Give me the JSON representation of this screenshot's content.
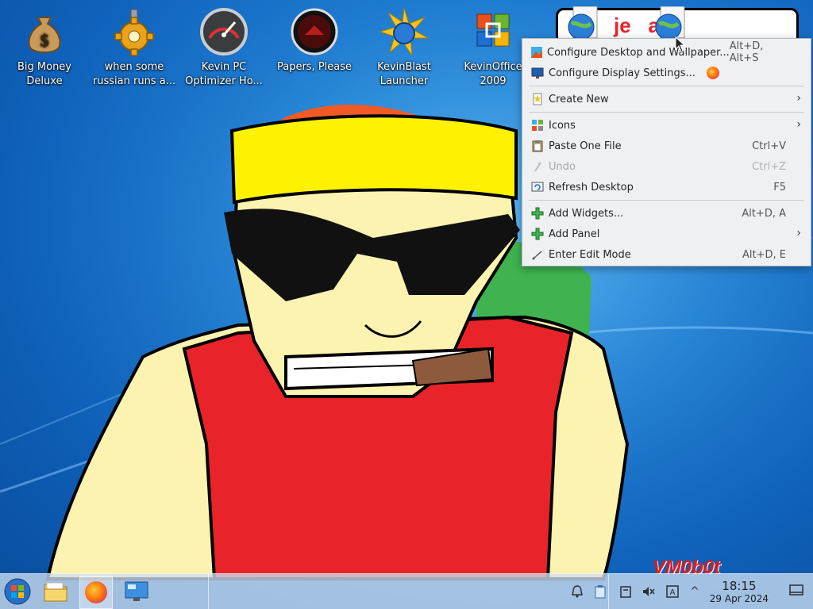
{
  "desktop": {
    "icons": [
      {
        "label_1": "Big Money",
        "label_2": "Deluxe",
        "icon": "money-bag-icon"
      },
      {
        "label_1": "when some",
        "label_2": "russian runs a...",
        "icon": "gear-icon"
      },
      {
        "label_1": "Kevin PC",
        "label_2": "Optimizer Ho...",
        "icon": "speedometer-icon"
      },
      {
        "label_1": "Papers, Please",
        "label_2": "",
        "icon": "seal-icon"
      },
      {
        "label_1": "KevinBlast",
        "label_2": "Launcher",
        "icon": "starburst-icon"
      },
      {
        "label_1": "KevinOffice",
        "label_2": "2009",
        "icon": "office-logo-icon"
      }
    ],
    "watermark": "VM0b0t",
    "banner_fragment": "je   ally"
  },
  "context_menu": {
    "items": [
      {
        "label": "Configure Desktop and Wallpaper...",
        "shortcut": "Alt+D, Alt+S"
      },
      {
        "label": "Configure Display Settings...",
        "shortcut": ""
      },
      {
        "label": "Create New",
        "shortcut": ""
      },
      {
        "label": "Icons",
        "shortcut": ""
      },
      {
        "label": "Paste One File",
        "shortcut": "Ctrl+V"
      },
      {
        "label": "Undo",
        "shortcut": "Ctrl+Z"
      },
      {
        "label": "Refresh Desktop",
        "shortcut": "F5"
      },
      {
        "label": "Add Widgets...",
        "shortcut": "Alt+D, A"
      },
      {
        "label": "Add Panel",
        "shortcut": ""
      },
      {
        "label": "Enter Edit Mode",
        "shortcut": "Alt+D, E"
      }
    ],
    "submenu_arrow": "›"
  },
  "taskbar": {
    "clock_time": "18:15",
    "clock_date": "29 Apr 2024",
    "tray_expand": "^"
  },
  "colors": {
    "accent": "#3daee9",
    "menu_bg": "#eff0f1",
    "taskbar_bg": "#cddef0"
  }
}
